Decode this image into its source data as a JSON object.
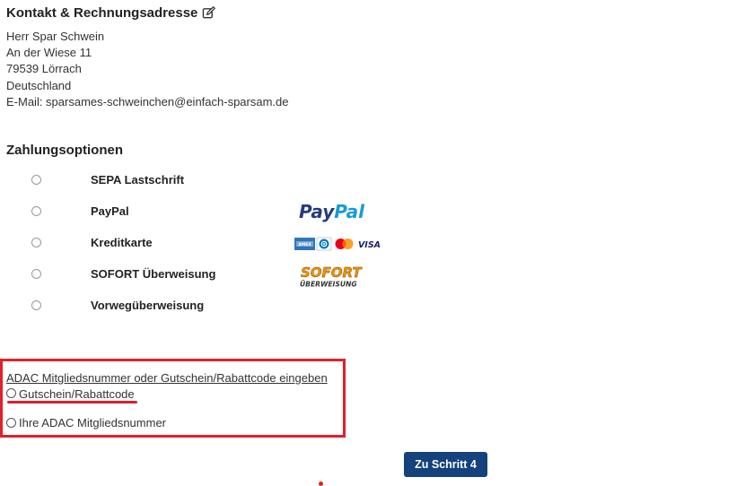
{
  "contact": {
    "title": "Kontakt & Rechnungsadresse",
    "lines": [
      "Herr Spar Schwein",
      "An der Wiese 11",
      "79539 Lörrach",
      "Deutschland",
      "E-Mail: sparsames-schweinchen@einfach-sparsam.de"
    ]
  },
  "payment": {
    "title": "Zahlungsoptionen",
    "options": [
      {
        "label": "SEPA Lastschrift"
      },
      {
        "label": "PayPal",
        "logo_text": "PayPal"
      },
      {
        "label": "Kreditkarte",
        "logo_cards": [
          "AMEX",
          "D",
          "",
          "VISA"
        ]
      },
      {
        "label": "SOFORT Überweisung",
        "logo_text_top": "SOFORT",
        "logo_text_bottom": "ÜBERWEISUNG"
      },
      {
        "label": "Vorwegüberweisung"
      }
    ]
  },
  "voucher": {
    "link_text": "ADAC Mitgliedsnummer oder Gutschein/Rabattcode eingeben",
    "options": [
      {
        "label": "Gutschein/Rabattcode"
      },
      {
        "label": "Ihre ADAC Mitgliedsnummer"
      }
    ]
  },
  "next_button": {
    "label": "Zu Schritt 4"
  },
  "colors": {
    "accent": "#14427d",
    "highlight": "#e0202a",
    "paypal_dark": "#253b80",
    "paypal_light": "#179bd7",
    "sofort_orange": "#f39200"
  }
}
